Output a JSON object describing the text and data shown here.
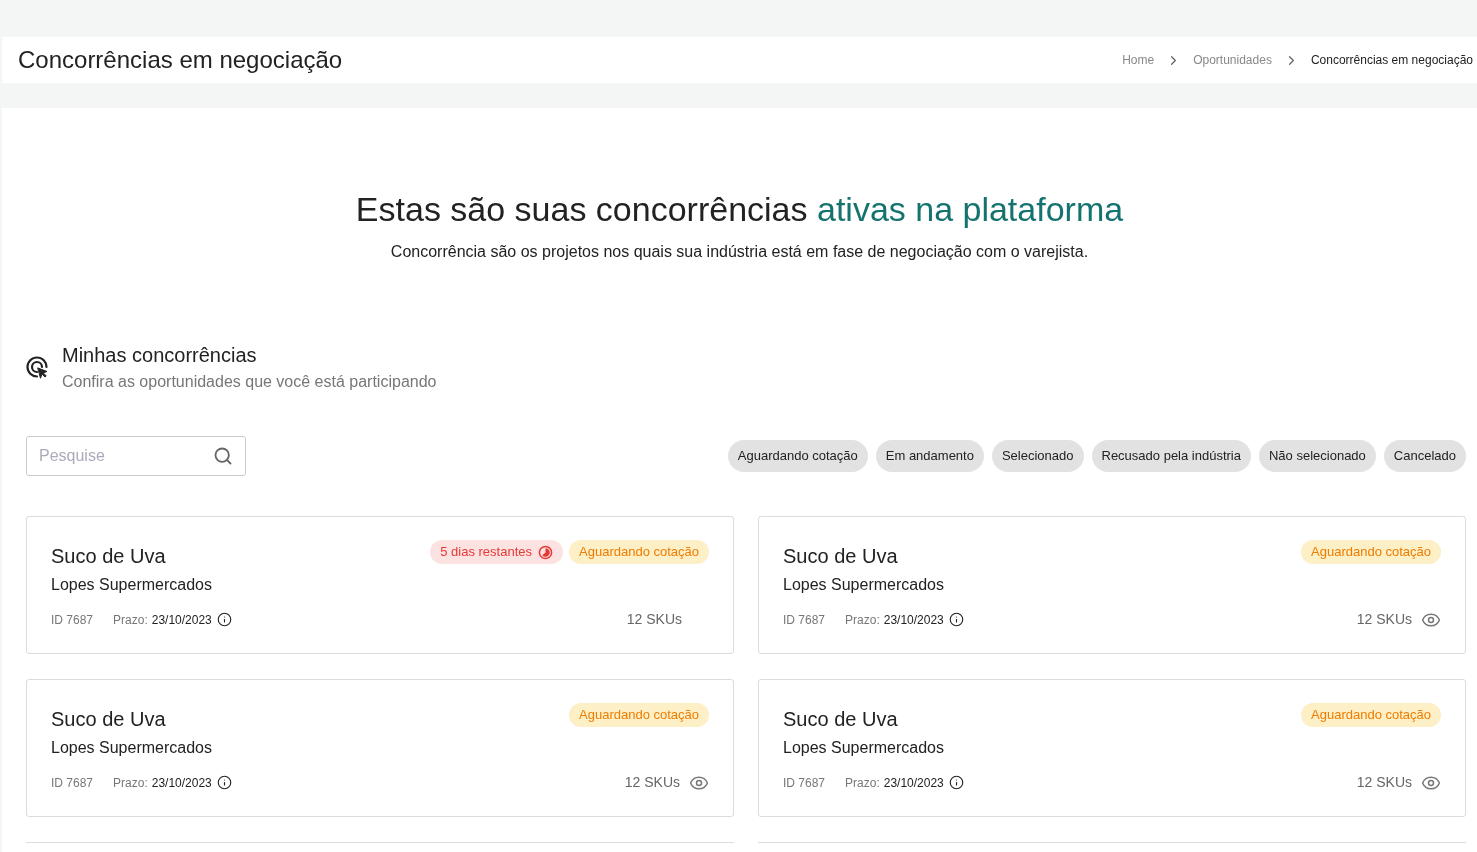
{
  "header": {
    "title": "Concorrências em negociação",
    "breadcrumbs": [
      {
        "label": "Home",
        "current": false
      },
      {
        "label": "Oportunidades",
        "current": false
      },
      {
        "label": "Concorrências em negociação",
        "current": true
      }
    ]
  },
  "hero": {
    "title": "Estas são suas concorrências",
    "title_highlight": "ativas na plataforma",
    "subtitle": "Concorrência são os projetos nos quais sua indústria está em fase de negociação com o varejista."
  },
  "section": {
    "title": "Minhas concorrências",
    "subtitle": "Confira as oportunidades que você está participando"
  },
  "search": {
    "placeholder": "Pesquise"
  },
  "filters": [
    {
      "label": "Aguardando cotação",
      "selected": false
    },
    {
      "label": "Em andamento",
      "selected": false
    },
    {
      "label": "Selecionado",
      "selected": false
    },
    {
      "label": "Recusado pela indústria",
      "selected": false
    },
    {
      "label": "Não selecionado",
      "selected": false
    },
    {
      "label": "Cancelado",
      "selected": false
    }
  ],
  "cards": [
    {
      "title": "Suco de Uva",
      "company": "Lopes Supermercados",
      "id": "ID 7687",
      "deadline_label": "Prazo:",
      "deadline": "23/10/2023",
      "skus": "12 SKUs",
      "remaining": "5 dias restantes",
      "status": "Aguardando cotação",
      "viewable": false
    },
    {
      "title": "Suco de Uva",
      "company": "Lopes Supermercados",
      "id": "ID 7687",
      "deadline_label": "Prazo:",
      "deadline": "23/10/2023",
      "skus": "12 SKUs",
      "status": "Aguardando cotação",
      "viewable": true
    },
    {
      "title": "Suco de Uva",
      "company": "Lopes Supermercados",
      "id": "ID 7687",
      "deadline_label": "Prazo:",
      "deadline": "23/10/2023",
      "skus": "12 SKUs",
      "status": "Aguardando cotação",
      "viewable": true
    },
    {
      "title": "Suco de Uva",
      "company": "Lopes Supermercados",
      "id": "ID 7687",
      "deadline_label": "Prazo:",
      "deadline": "23/10/2023",
      "skus": "12 SKUs",
      "status": "Aguardando cotação",
      "viewable": true
    }
  ]
}
